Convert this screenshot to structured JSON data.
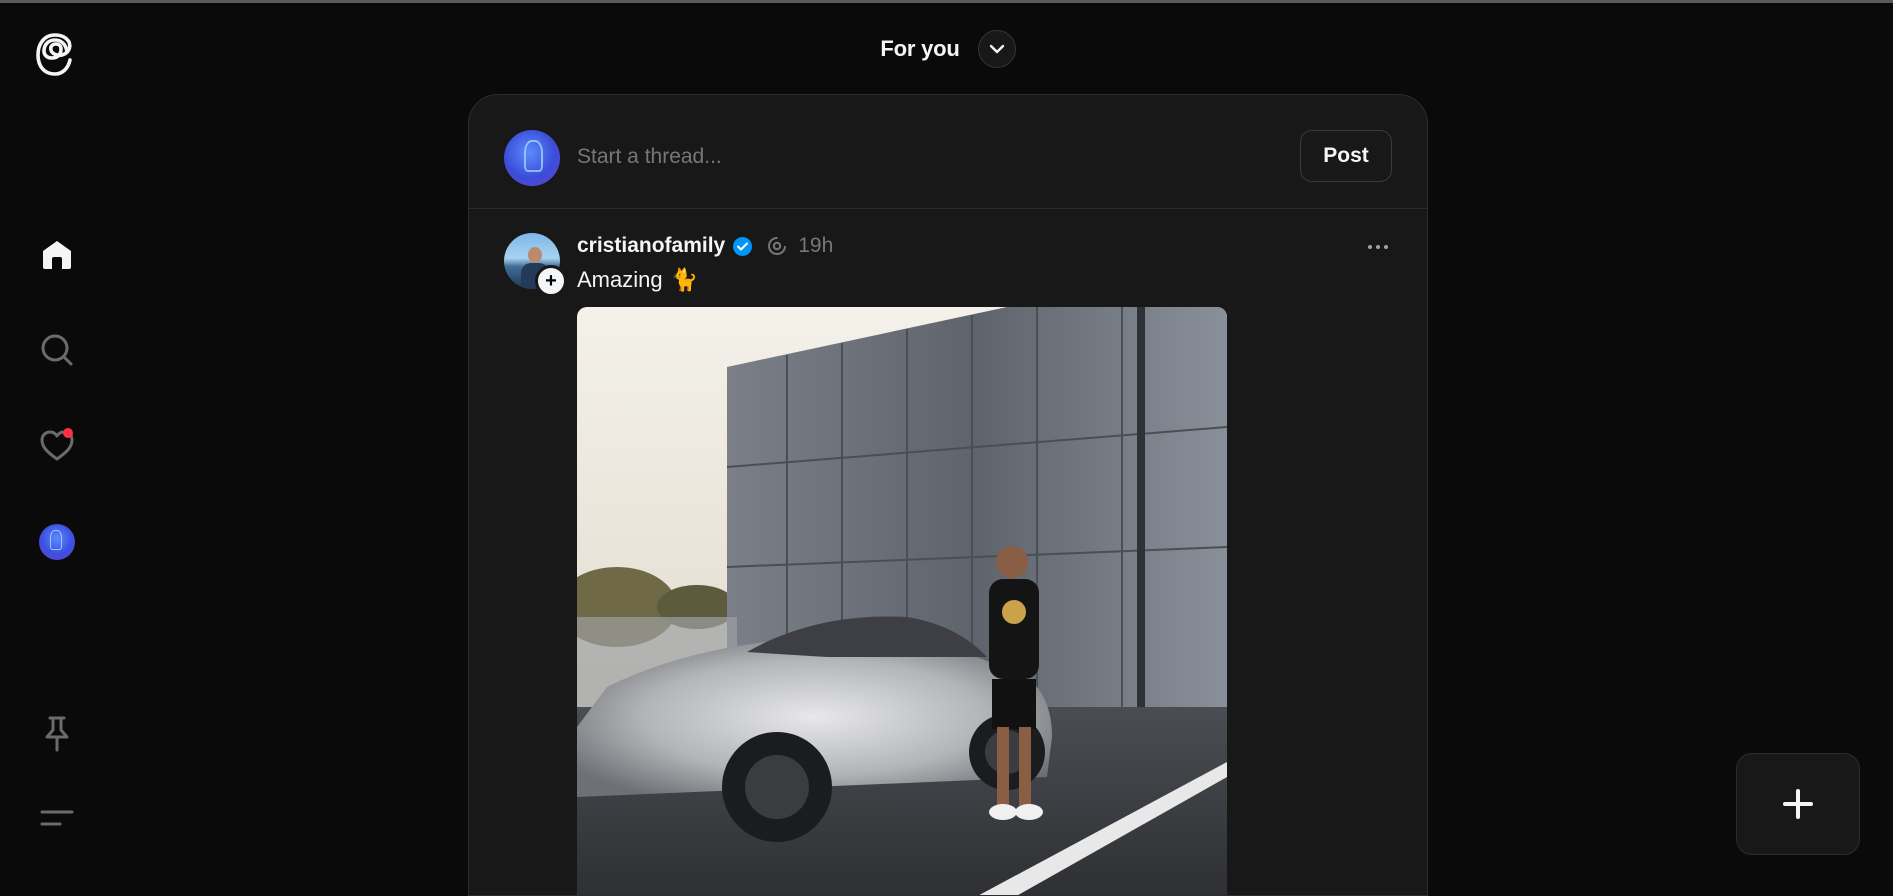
{
  "header": {
    "feed_title": "For you"
  },
  "nav": {
    "logo": "threads-logo-icon",
    "items": [
      {
        "name": "home",
        "icon": "home-icon",
        "active": true
      },
      {
        "name": "search",
        "icon": "search-icon"
      },
      {
        "name": "activity",
        "icon": "heart-icon",
        "has_notification": true
      },
      {
        "name": "profile",
        "icon": "avatar"
      },
      {
        "name": "pinned",
        "icon": "pin-icon"
      },
      {
        "name": "menu",
        "icon": "menu-icon"
      }
    ]
  },
  "composer": {
    "placeholder": "Start a thread...",
    "post_label": "Post"
  },
  "post": {
    "username": "cristianofamily",
    "verified": true,
    "time": "19h",
    "text": "Amazing",
    "emoji": "🐈",
    "image_alt": "man standing next to a crystal-covered SUV in front of a grey building"
  },
  "fab": {
    "icon": "plus-icon"
  },
  "colors": {
    "background": "#0a0a0a",
    "card": "#181818",
    "border": "#2d2d2d",
    "text": "#f3f5f7",
    "muted": "#777777",
    "verified": "#0095f6",
    "notification": "#ff3040"
  }
}
